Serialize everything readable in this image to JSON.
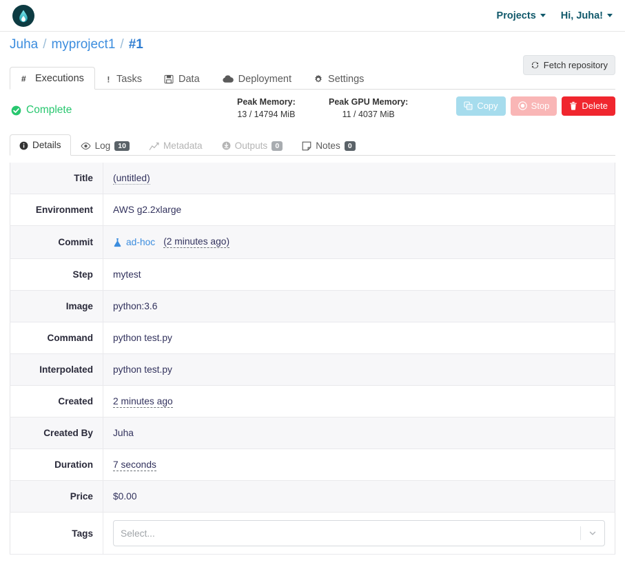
{
  "navbar": {
    "logo_icon": "app-logo-flame-icon",
    "links": [
      {
        "label": "Projects",
        "icon": "chevron-down-icon"
      },
      {
        "label": "Hi, Juha!",
        "icon": "chevron-down-icon"
      }
    ]
  },
  "breadcrumb": {
    "user": "Juha",
    "sep1": "/",
    "project": "myproject1",
    "sep2": "/",
    "current": "#1"
  },
  "tabs": [
    {
      "label": "Executions",
      "icon": "hash-icon",
      "active": true
    },
    {
      "label": "Tasks",
      "icon": "exclamation-icon",
      "active": false
    },
    {
      "label": "Data",
      "icon": "floppy-disk-icon",
      "active": false
    },
    {
      "label": "Deployment",
      "icon": "cloud-icon",
      "active": false
    },
    {
      "label": "Settings",
      "icon": "gear-icon",
      "active": false
    }
  ],
  "fetch_button": {
    "label": "Fetch repository",
    "icon": "sync-icon"
  },
  "status": {
    "label": "Complete",
    "icon": "check-circle-icon",
    "color": "#28c76f"
  },
  "memory": {
    "peak_memory_title": "Peak Memory:",
    "peak_memory_value": "13 / 14794 MiB",
    "peak_gpu_title": "Peak GPU Memory:",
    "peak_gpu_value": "11 / 4037 MiB"
  },
  "actions": [
    {
      "label": "Copy",
      "icon": "copy-icon",
      "color": "#a6dced",
      "disabled": true
    },
    {
      "label": "Stop",
      "icon": "stop-circle-icon",
      "color": "#f9b6b6",
      "disabled": true
    },
    {
      "label": "Delete",
      "icon": "trash-icon",
      "color": "#f0262e",
      "disabled": false
    }
  ],
  "subtabs": [
    {
      "label": "Details",
      "icon": "info-circle-icon",
      "badge": null,
      "active": true,
      "muted": false
    },
    {
      "label": "Log",
      "icon": "eye-icon",
      "badge": "10",
      "active": false,
      "muted": false
    },
    {
      "label": "Metadata",
      "icon": "chart-line-icon",
      "badge": null,
      "active": false,
      "muted": true
    },
    {
      "label": "Outputs",
      "icon": "download-circle-icon",
      "badge": "0",
      "active": false,
      "muted": true
    },
    {
      "label": "Notes",
      "icon": "sticky-note-icon",
      "badge": "0",
      "active": false,
      "muted": false
    }
  ],
  "details": {
    "title_label": "Title",
    "title_value": "(untitled)",
    "environment_label": "Environment",
    "environment_value": "AWS g2.2xlarge",
    "commit_label": "Commit",
    "commit_icon": "flask-icon",
    "commit_value": "ad-hoc",
    "commit_time": "(2 minutes ago)",
    "step_label": "Step",
    "step_value": "mytest",
    "image_label": "Image",
    "image_value": "python:3.6",
    "command_label": "Command",
    "command_value": "python test.py",
    "interpolated_label": "Interpolated",
    "interpolated_value": "python test.py",
    "created_label": "Created",
    "created_value": "2 minutes ago",
    "created_by_label": "Created By",
    "created_by_value": "Juha",
    "duration_label": "Duration",
    "duration_value": "7 seconds",
    "price_label": "Price",
    "price_value": "$0.00",
    "tags_label": "Tags",
    "tags_placeholder": "Select...",
    "tags_arrow_icon": "chevron-down-icon"
  }
}
